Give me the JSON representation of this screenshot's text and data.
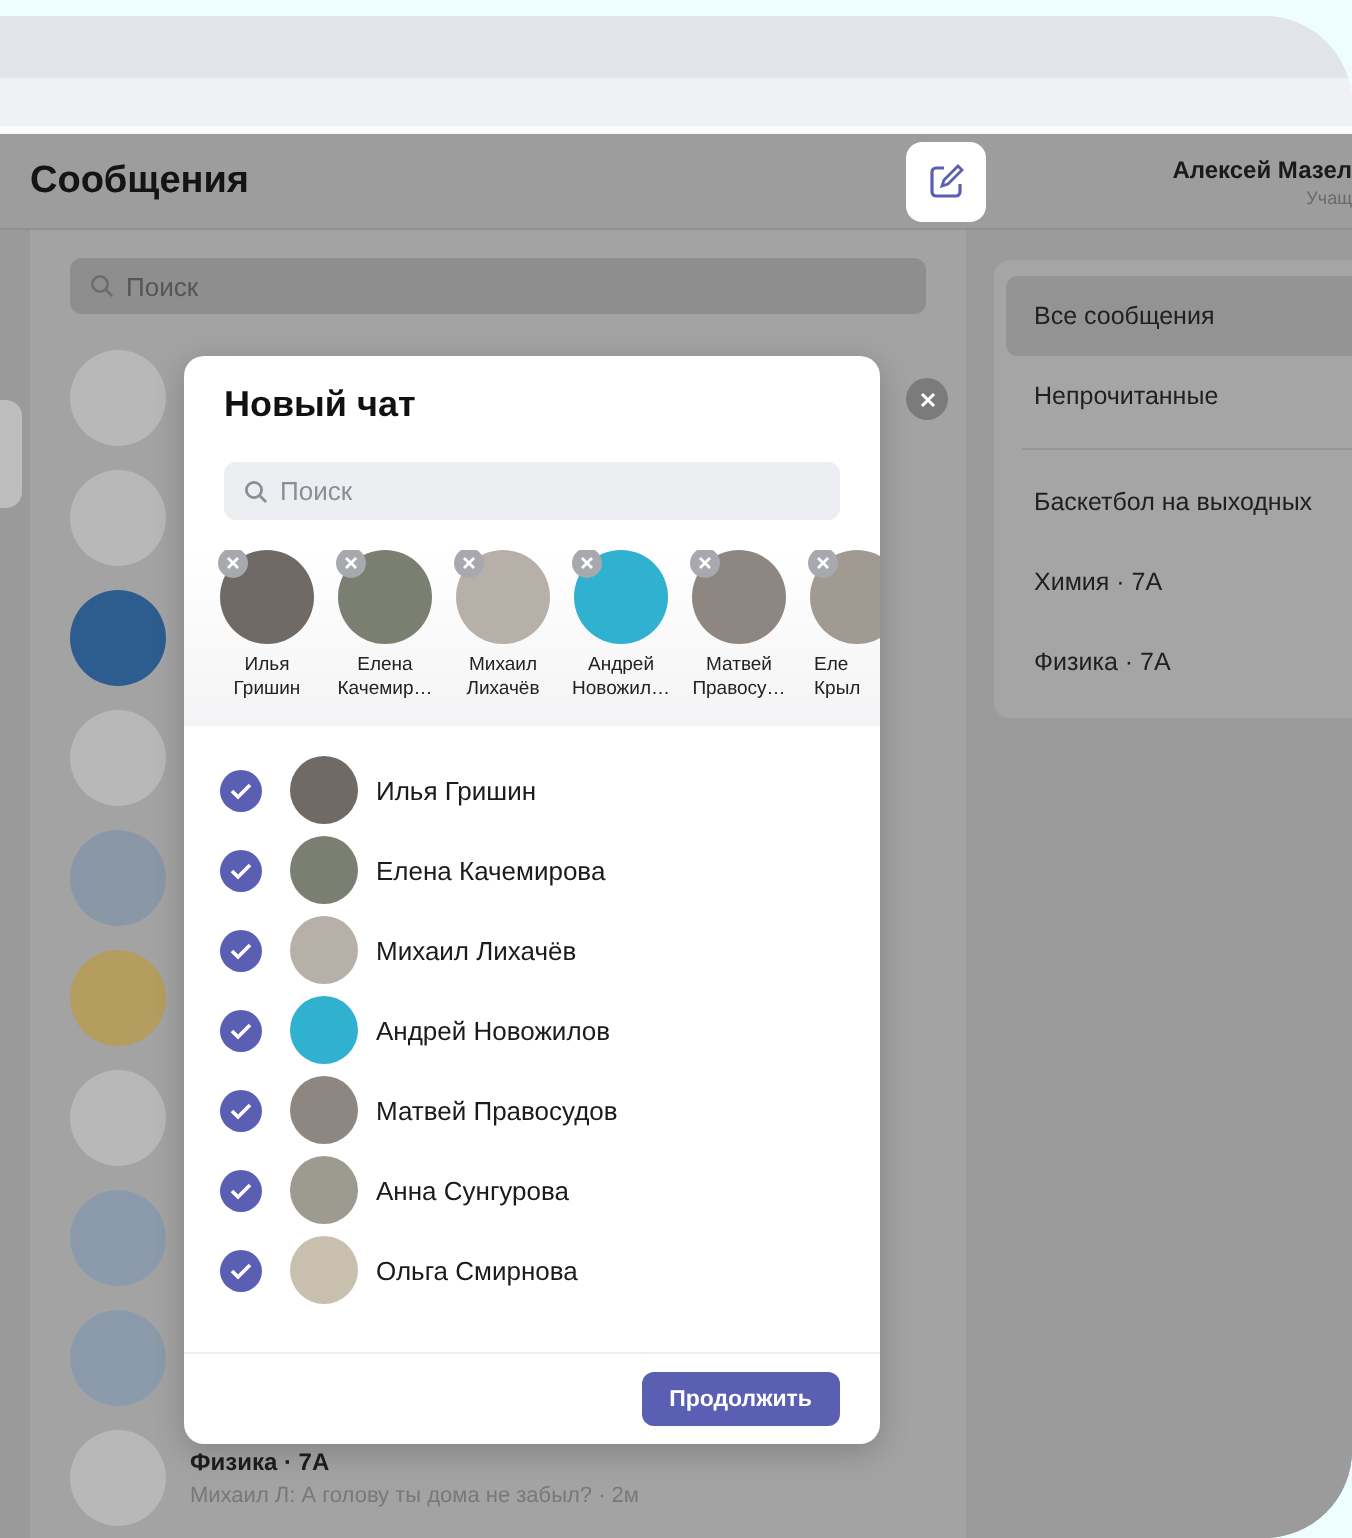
{
  "header": {
    "title": "Сообщения",
    "user_name": "Алексей Мазел",
    "user_role": "Учащ"
  },
  "chat_list": {
    "search_placeholder": "Поиск",
    "chats": [
      {
        "title": "Физика · 7А",
        "preview": "Михаил Л: А голову ты дома не забыл? · 2м"
      }
    ]
  },
  "right_panel": {
    "filters": [
      {
        "label": "Все сообщения",
        "selected": true
      },
      {
        "label": "Непрочитанные",
        "selected": false
      }
    ],
    "chats": [
      {
        "label": "Баскетбол на выходных",
        "selected": false
      },
      {
        "label": "Химия · 7А",
        "selected": false
      },
      {
        "label": "Физика · 7А",
        "selected": false
      }
    ]
  },
  "modal": {
    "title": "Новый чат",
    "search_placeholder": "Поиск",
    "chips": [
      {
        "first": "Илья",
        "last": "Гришин"
      },
      {
        "first": "Елена",
        "last": "Качемир…"
      },
      {
        "first": "Михаил",
        "last": "Лихачёв"
      },
      {
        "first": "Андрей",
        "last": "Новожил…"
      },
      {
        "first": "Матвей",
        "last": "Правосу…"
      },
      {
        "first": "Еле",
        "last": "Крыл"
      }
    ],
    "contacts": [
      {
        "name": "Илья Гришин",
        "checked": true
      },
      {
        "name": "Елена Качемирова",
        "checked": true
      },
      {
        "name": "Михаил Лихачёв",
        "checked": true
      },
      {
        "name": "Андрей Новожилов",
        "checked": true
      },
      {
        "name": "Матвей Правосудов",
        "checked": true
      },
      {
        "name": "Анна Сунгурова",
        "checked": true
      },
      {
        "name": "Ольга Смирнова",
        "checked": true
      }
    ],
    "button": "Продолжить"
  }
}
